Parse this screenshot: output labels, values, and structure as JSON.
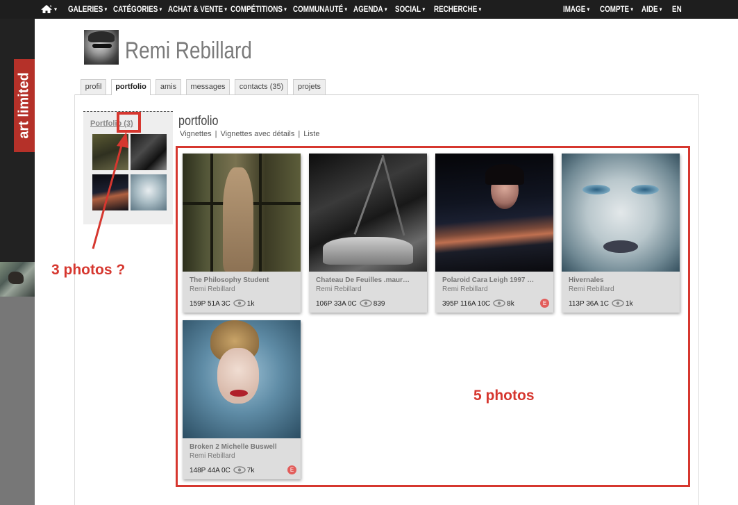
{
  "nav": {
    "left": [
      {
        "label": "GALERIES"
      },
      {
        "label": "CATÉGORIES"
      },
      {
        "label": "ACHAT & VENTE"
      },
      {
        "label": "COMPÉTITIONS"
      },
      {
        "label": "COMMUNAUTÉ"
      },
      {
        "label": "AGENDA"
      },
      {
        "label": "SOCIAL"
      },
      {
        "label": "RECHERCHE"
      }
    ],
    "right": [
      {
        "label": "IMAGE"
      },
      {
        "label": "COMPTE"
      },
      {
        "label": "AIDE"
      },
      {
        "label": "EN"
      }
    ],
    "caret": "▾"
  },
  "brand": "art limited",
  "profile": {
    "name": "Remi Rebillard"
  },
  "tabs": [
    {
      "label": "profil"
    },
    {
      "label": "portfolio"
    },
    {
      "label": "amis"
    },
    {
      "label": "messages"
    },
    {
      "label": "contacts (35)"
    },
    {
      "label": "projets"
    }
  ],
  "sidebar": {
    "title": "Portfolio (3)"
  },
  "portfolio": {
    "title": "portfolio",
    "views": [
      "Vignettes",
      "Vignettes avec détails",
      "Liste"
    ],
    "separator": "|"
  },
  "cards": [
    {
      "title": "The Philosophy Student",
      "author": "Remi Rebillard",
      "stats": "159P 51A 3C",
      "views": "1k",
      "badge": ""
    },
    {
      "title": "Chateau De Feuilles .maur…",
      "author": "Remi Rebillard",
      "stats": "106P 33A 0C",
      "views": "839",
      "badge": ""
    },
    {
      "title": "Polaroid Cara Leigh 1997 …",
      "author": "Remi Rebillard",
      "stats": "395P 116A 10C",
      "views": "8k",
      "badge": "E"
    },
    {
      "title": "Hivernales",
      "author": "Remi Rebillard",
      "stats": "113P 36A 1C",
      "views": "1k",
      "badge": ""
    },
    {
      "title": "Broken 2 Michelle Buswell",
      "author": "Remi Rebillard",
      "stats": "148P 44A 0C",
      "views": "7k",
      "badge": "E"
    }
  ],
  "annotations": {
    "left_label": "3 photos ?",
    "right_label": "5 photos"
  },
  "colors": {
    "accent_red": "#d6372f",
    "nav_bg": "#1e1e1e",
    "brand_red": "#b53129"
  }
}
